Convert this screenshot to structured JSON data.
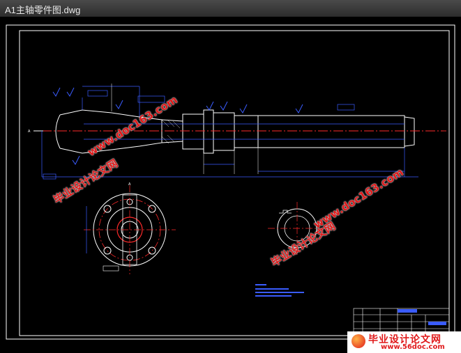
{
  "window": {
    "title": "A1主轴零件图.dwg"
  },
  "watermarks": {
    "site_name": "毕业设计论文网",
    "url": "www.doc163.com"
  },
  "footer_logo": {
    "name": "毕业设计论文网",
    "url": "www.56doc.com"
  },
  "drawing": {
    "section_marker": "A",
    "colors": {
      "background": "#000000",
      "outline": "#ffffff",
      "dimension": "#3a5cff",
      "centerline": "#ff2a2a",
      "red": "#e0191a"
    }
  }
}
